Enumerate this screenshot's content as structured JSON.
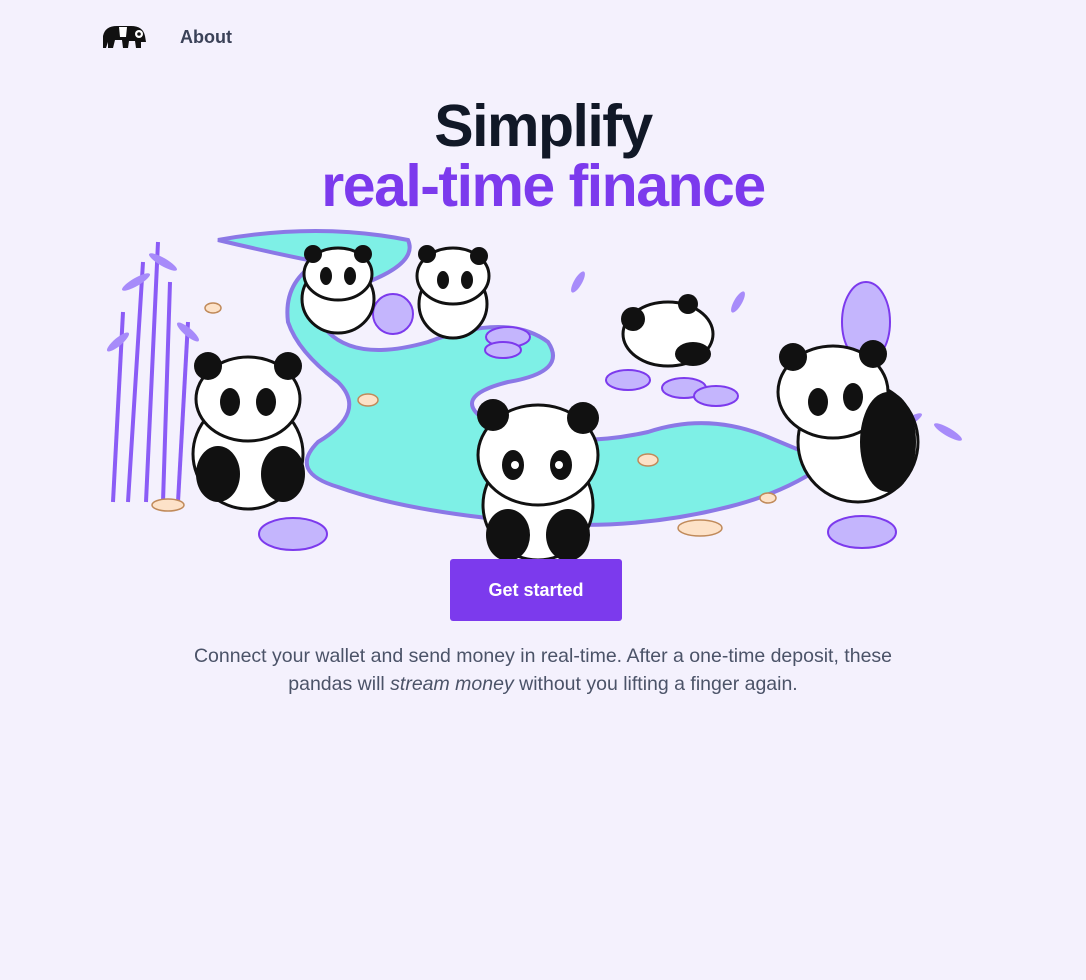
{
  "nav": {
    "logo_name": "panda-logo",
    "about_label": "About"
  },
  "hero": {
    "title_line1": "Simplify",
    "title_line2": "real-time finance"
  },
  "cta": {
    "label": "Get started"
  },
  "description": {
    "part1": "Connect your wallet and send money in real-time. After a one-time deposit, these pandas will",
    "emphasis": "stream money",
    "part2": "without you lifting a finger again."
  },
  "colors": {
    "background": "#f4f1fd",
    "accent": "#7c3aed",
    "title_dark": "#111827",
    "body_text": "#4b5368",
    "stream": "#7ef0e6"
  },
  "illustration": {
    "subject": "pandas by a stream with bamboo and ethereum coins"
  }
}
